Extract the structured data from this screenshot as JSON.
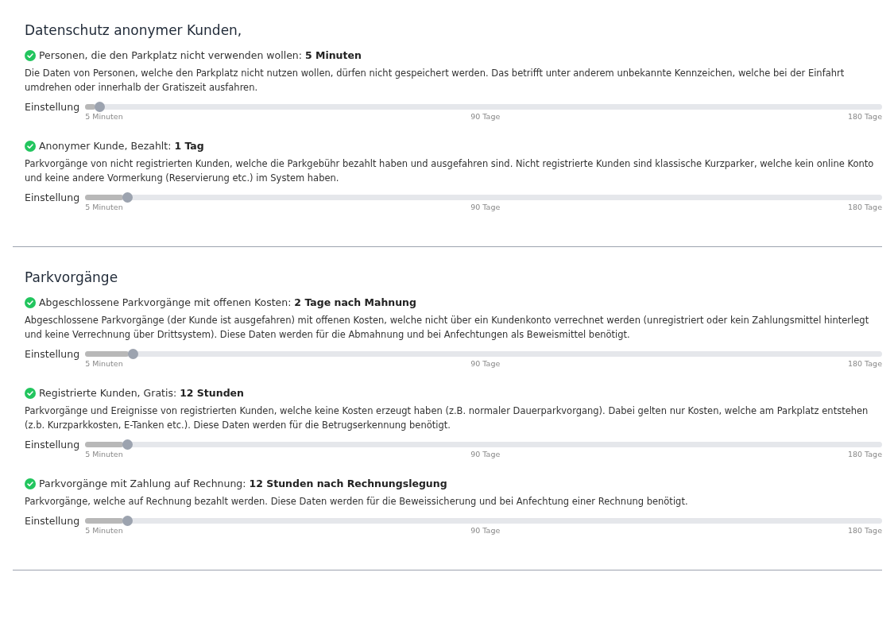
{
  "sections": [
    {
      "heading": "Datenschutz anonymer Kunden,",
      "items": [
        {
          "label": "Personen, die den Parkplatz nicht verwenden wollen:",
          "value": "5 Minuten",
          "checked": true,
          "description": "Die Daten von Personen, welche den Parkplatz nicht nutzen wollen, dürfen nicht gespeichert werden. Das betrifft unter anderem unbekannte Kennzeichen, welche bei der Einfahrt umdrehen oder innerhalb der Gratiszeit ausfahren.",
          "setting_label": "Einstellung",
          "level": 0.013,
          "ticks": [
            "5 Minuten",
            "90 Tage",
            "180 Tage"
          ]
        },
        {
          "label": "Anonymer Kunde, Bezahlt:",
          "value": "1 Tag",
          "checked": true,
          "description": "Parkvorgänge von nicht registrierten Kunden, welche die Parkgebühr bezahlt haben und ausgefahren sind. Nicht registrierte Kunden sind klassische Kurzparker, welche kein online Konto und keine andere Vormerkung (Reservierung etc.) im System haben.",
          "setting_label": "Einstellung",
          "level": 0.048,
          "ticks": [
            "5 Minuten",
            "90 Tage",
            "180 Tage"
          ]
        }
      ]
    },
    {
      "heading": "Parkvorgänge",
      "items": [
        {
          "label": "Abgeschlossene Parkvorgänge mit offenen Kosten:",
          "value": "2 Tage nach Mahnung",
          "checked": true,
          "description": "Abgeschlossene Parkvorgänge (der Kunde ist ausgefahren) mit offenen Kosten, welche nicht über ein Kundenkonto verrechnet werden (unregistriert oder kein Zahlungsmittel hinterlegt und keine Verrechnung über Drittsystem). Diese Daten werden für die Abmahnung und bei Anfechtungen als Beweismittel benötigt.",
          "setting_label": "Einstellung",
          "level": 0.055,
          "ticks": [
            "5 Minuten",
            "90 Tage",
            "180 Tage"
          ]
        },
        {
          "label": "Registrierte Kunden, Gratis:",
          "value": "12 Stunden",
          "checked": true,
          "description": "Parkvorgänge und Ereignisse von registrierten Kunden, welche keine Kosten erzeugt haben (z.B. normaler Dauerparkvorgang). Dabei gelten nur Kosten, welche am Parkplatz entstehen (z.b. Kurzparkkosten, E-Tanken etc.). Diese Daten werden für die Betrugserkennung benötigt.",
          "setting_label": "Einstellung",
          "level": 0.048,
          "ticks": [
            "5 Minuten",
            "90 Tage",
            "180 Tage"
          ]
        },
        {
          "label": "Parkvorgänge mit Zahlung auf Rechnung:",
          "value": "12 Stunden nach Rechnungslegung",
          "checked": true,
          "description": "Parkvorgänge, welche auf Rechnung bezahlt werden. Diese Daten werden für die Beweissicherung und bei Anfechtung einer Rechnung benötigt.",
          "setting_label": "Einstellung",
          "level": 0.048,
          "ticks": [
            "5 Minuten",
            "90 Tage",
            "180 Tage"
          ]
        }
      ]
    }
  ]
}
